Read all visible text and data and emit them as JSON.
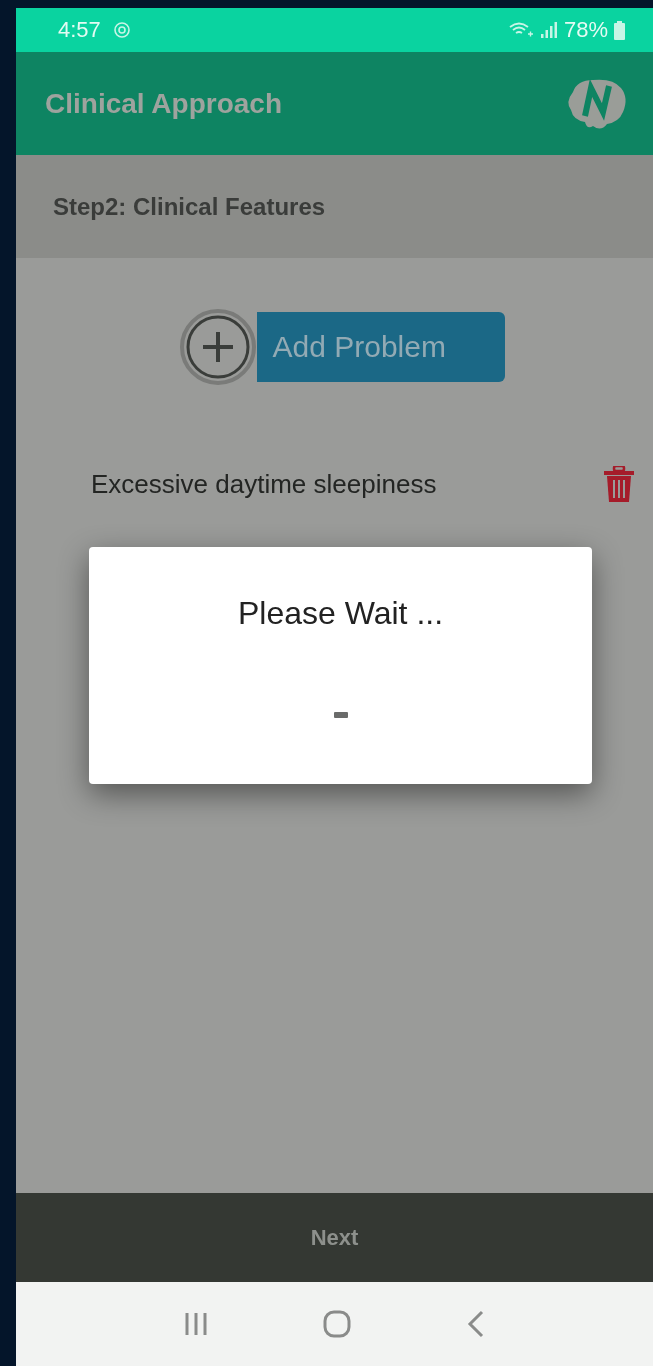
{
  "status_bar": {
    "time": "4:57",
    "battery": "78%"
  },
  "app_bar": {
    "title": "Clinical Approach"
  },
  "step_header": {
    "title": "Step2: Clinical Features"
  },
  "add_button": {
    "label": "Add Problem"
  },
  "problems": [
    {
      "name": "Excessive daytime sleepiness"
    }
  ],
  "dialog": {
    "title": "Please Wait ..."
  },
  "footer": {
    "next_label": "Next"
  }
}
